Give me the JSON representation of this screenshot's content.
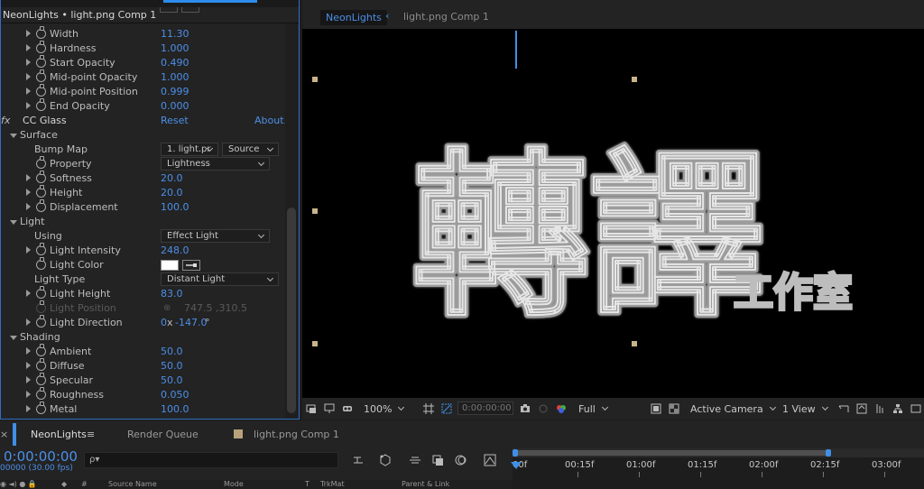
{
  "effect_controls": {
    "header": "NeonLights • light.png Comp 1",
    "rows": [
      {
        "kind": "prop",
        "label": "Width",
        "value": "11.30"
      },
      {
        "kind": "prop",
        "label": "Hardness",
        "value": "1.000"
      },
      {
        "kind": "prop",
        "label": "Start Opacity",
        "value": "0.490"
      },
      {
        "kind": "prop",
        "label": "Mid-point Opacity",
        "value": "1.000"
      },
      {
        "kind": "prop",
        "label": "Mid-point Position",
        "value": "0.999"
      },
      {
        "kind": "prop",
        "label": "End Opacity",
        "value": "0.000"
      }
    ],
    "cc_glass": {
      "fx": "fx",
      "name": "CC Glass",
      "reset": "Reset",
      "about": "About."
    },
    "surface": {
      "label": "Surface",
      "bump_map": {
        "label": "Bump Map",
        "layer": "1. light.pr",
        "source": "Source"
      },
      "property": {
        "label": "Property",
        "value": "Lightness"
      },
      "softness": {
        "label": "Softness",
        "value": "20.0"
      },
      "height": {
        "label": "Height",
        "value": "20.0"
      },
      "displacement": {
        "label": "Displacement",
        "value": "100.0"
      }
    },
    "light": {
      "label": "Light",
      "using": {
        "label": "Using",
        "value": "Effect Light"
      },
      "intensity": {
        "label": "Light Intensity",
        "value": "248.0"
      },
      "color": {
        "label": "Light Color",
        "swatch": "#ffffff"
      },
      "type": {
        "label": "Light Type",
        "value": "Distant Light"
      },
      "height": {
        "label": "Light Height",
        "value": "83.0"
      },
      "position": {
        "label": "Light Position",
        "value": "747.5 ,310.5"
      },
      "direction": {
        "label": "Light Direction",
        "value_rev": "0",
        "value_x": "x",
        "value_deg": "-147.0",
        "deg": "°"
      }
    },
    "shading": {
      "label": "Shading",
      "ambient": {
        "label": "Ambient",
        "value": "50.0"
      },
      "diffuse": {
        "label": "Diffuse",
        "value": "50.0"
      },
      "specular": {
        "label": "Specular",
        "value": "50.0"
      },
      "roughness": {
        "label": "Roughness",
        "value": "0.050"
      },
      "metal": {
        "label": "Metal",
        "value": "100.0"
      }
    }
  },
  "viewer": {
    "tab_active": "NeonLights",
    "tab_arrow": "‹",
    "tab_other": "light.png Comp 1",
    "artwork_main": "轉譯",
    "artwork_sub": "工作室",
    "toolbar": {
      "zoom": "100%",
      "timecode": "0:00:00:00",
      "resolution": "Full",
      "camera": "Active Camera",
      "views": "1 View"
    }
  },
  "timeline": {
    "tab_comp": "NeonLights",
    "menu_icon": "≡",
    "tab_render": "Render Queue",
    "tab_other": "light.png Comp 1",
    "time": "0:00:00:00",
    "fps": "00000 (30.00 fps)",
    "search_icon": "ρ▾",
    "columns": {
      "hash": "#",
      "source": "Source Name",
      "mode": "Mode",
      "t": "T",
      "trkmat": "TrkMat",
      "parent": "Parent & Link"
    },
    "ruler": [
      "00f",
      "00:15f",
      "01:00f",
      "01:15f",
      "02:00f",
      "02:15f",
      "03:00f"
    ],
    "close": "×"
  },
  "colors": {
    "accent": "#4c8fe8",
    "panel": "#232323",
    "handle": "#c9b48a"
  }
}
